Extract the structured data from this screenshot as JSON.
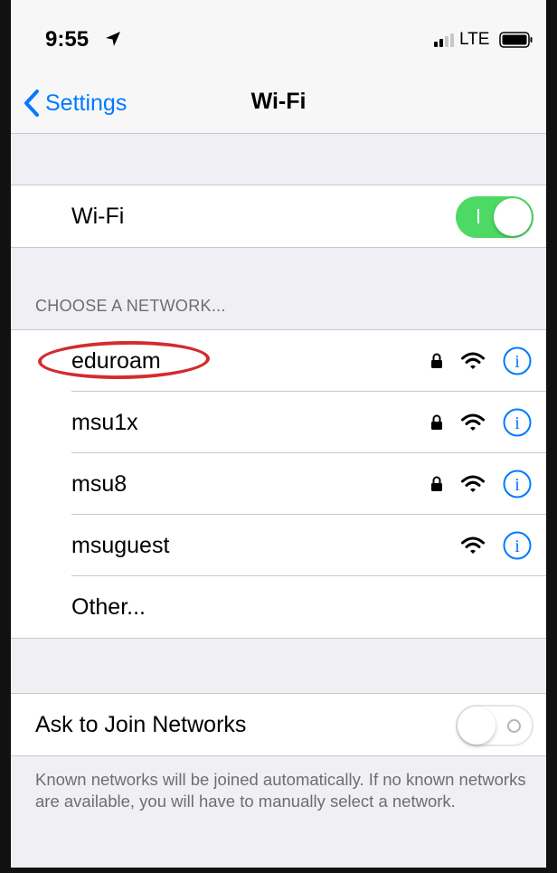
{
  "status_bar": {
    "time": "9:55",
    "carrier": "LTE",
    "location_icon": "location-arrow-icon",
    "signal_icon": "cell-signal-icon",
    "battery_icon": "battery-icon"
  },
  "nav": {
    "back_label": "Settings",
    "title": "Wi-Fi"
  },
  "wifi_toggle": {
    "label": "Wi-Fi",
    "enabled": true
  },
  "networks_section": {
    "header": "CHOOSE A NETWORK...",
    "networks": [
      {
        "name": "eduroam",
        "locked": true,
        "highlighted": true
      },
      {
        "name": "msu1x",
        "locked": true,
        "highlighted": false
      },
      {
        "name": "msu8",
        "locked": true,
        "highlighted": false
      },
      {
        "name": "msuguest",
        "locked": false,
        "highlighted": false
      }
    ],
    "other_label": "Other..."
  },
  "ask_to_join": {
    "label": "Ask to Join Networks",
    "enabled": false,
    "footer": "Known networks will be joined automatically. If no known networks are available, you will have to manually select a network."
  },
  "colors": {
    "accent": "#007aff",
    "switch_on": "#4cd964",
    "highlight": "#d42b2f",
    "background": "#efeff4"
  }
}
